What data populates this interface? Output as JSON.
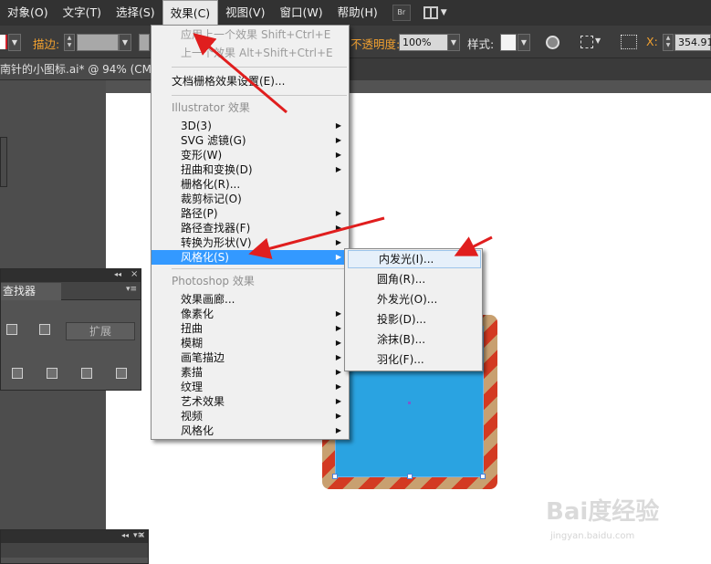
{
  "menubar": {
    "items": [
      "对象(O)",
      "文字(T)",
      "选择(S)",
      "效果(C)",
      "视图(V)",
      "窗口(W)",
      "帮助(H)"
    ],
    "bridge_label": "Br"
  },
  "controlbar": {
    "stroke_label": "描边:",
    "opacity_label": "不透明度:",
    "opacity_value": "100%",
    "style_label": "样式:",
    "x_label": "X:",
    "x_value": "354.91"
  },
  "document_tab": "南针的小图标.ai* @ 94% (CM",
  "effect_menu": {
    "apply_last": "应用上一个效果",
    "apply_last_shortcut": "Shift+Ctrl+E",
    "last_effect": "上一个效果",
    "last_effect_shortcut": "Alt+Shift+Ctrl+E",
    "raster_settings": "文档栅格效果设置(E)...",
    "illustrator_header": "Illustrator 效果",
    "illustrator_items": [
      "3D(3)",
      "SVG 滤镜(G)",
      "变形(W)",
      "扭曲和变换(D)",
      "栅格化(R)...",
      "裁剪标记(O)",
      "路径(P)",
      "路径查找器(F)",
      "转换为形状(V)",
      "风格化(S)"
    ],
    "photoshop_header": "Photoshop 效果",
    "photoshop_items": [
      "效果画廊...",
      "像素化",
      "扭曲",
      "模糊",
      "画笔描边",
      "素描",
      "纹理",
      "艺术效果",
      "视频",
      "风格化"
    ]
  },
  "stylize_submenu": {
    "items": [
      "内发光(I)...",
      "圆角(R)...",
      "外发光(O)...",
      "投影(D)...",
      "涂抹(B)...",
      "羽化(F)..."
    ]
  },
  "pathfinder_panel": {
    "tab_label": "查找器",
    "expand_label": "扩展"
  },
  "watermark": {
    "brand": "Bai度经验",
    "url": "jingyan.baidu.com"
  },
  "colors": {
    "selection_blue": "#3399ff",
    "art_blue": "#2aa3e1",
    "annotation_red": "#e01e1e",
    "ui_accent_orange": "#f0a030"
  }
}
